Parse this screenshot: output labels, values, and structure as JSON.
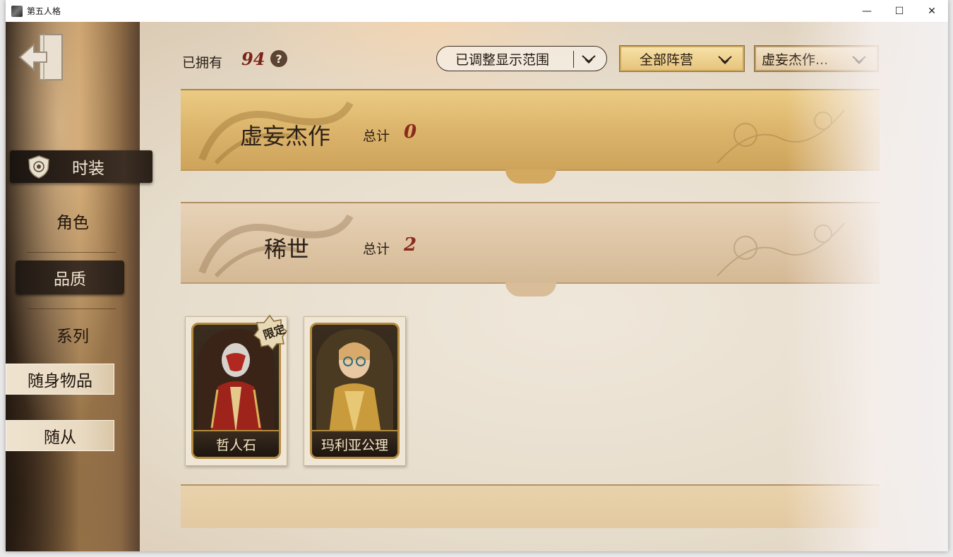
{
  "window": {
    "title": "第五人格",
    "minimize_glyph": "—",
    "maximize_glyph": "☐",
    "close_glyph": "✕"
  },
  "sidebar": {
    "items": [
      {
        "label": "时装",
        "icon": "emblem-icon",
        "state": "active"
      },
      {
        "label": "角色"
      },
      {
        "label": "品质",
        "state": "selected"
      },
      {
        "label": "系列"
      },
      {
        "label": "随身物品"
      },
      {
        "label": "随从"
      }
    ]
  },
  "header": {
    "owned_label": "已拥有",
    "owned_count": "94",
    "help_glyph": "?"
  },
  "filters": {
    "range": "已调整显示范围",
    "camp": "全部阵营",
    "series": "虚妄杰作..."
  },
  "categories": [
    {
      "title": "虚妄杰作",
      "total_label": "总计",
      "total": "0"
    },
    {
      "title": "稀世",
      "total_label": "总计",
      "total": "2"
    }
  ],
  "cards": [
    {
      "name": "哲人石",
      "badge": "限定"
    },
    {
      "name": "玛利亚公理",
      "badge": ""
    }
  ],
  "colors": {
    "accent_red": "#8a2a1d",
    "gold": "#dcb46b",
    "dark_panel": "#2e2218"
  }
}
